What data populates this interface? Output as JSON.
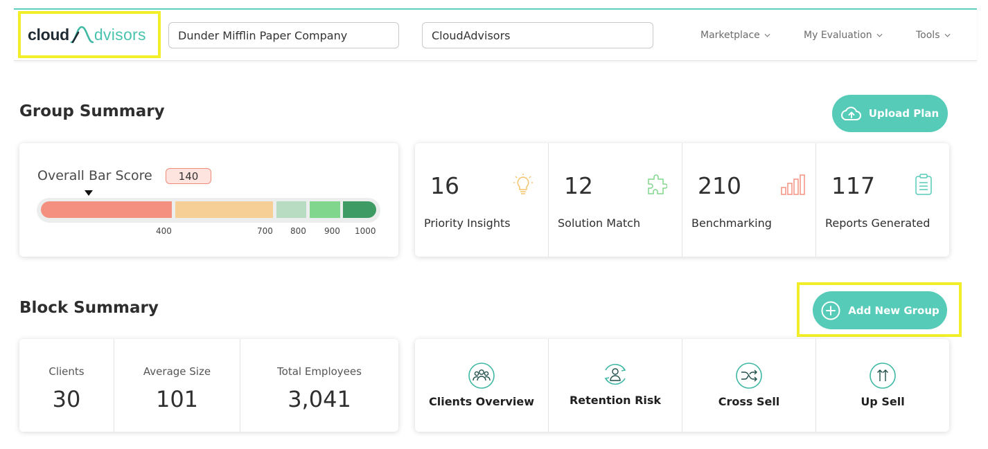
{
  "brand": {
    "logo_part1": "cloud",
    "logo_part2": "dvisors",
    "accent": "#55cbb8",
    "highlight": "#f2ef2a"
  },
  "header": {
    "company_field": "Dunder Mifflin Paper Company",
    "advisor_field": "CloudAdvisors",
    "nav": [
      {
        "label": "Marketplace",
        "icon": "chevron-down-icon"
      },
      {
        "label": "My Evaluation",
        "icon": "chevron-down-icon"
      },
      {
        "label": "Tools",
        "icon": "chevron-down-icon"
      }
    ]
  },
  "group_summary": {
    "title": "Group Summary",
    "upload_button": "Upload Plan",
    "bar_score": {
      "label": "Overall Bar Score",
      "value": "140",
      "ticks": [
        "400",
        "700",
        "800",
        "900",
        "1000"
      ],
      "segment_colors": [
        "#f4907f",
        "#f5cf95",
        "#b7dcc2",
        "#7fd68c",
        "#3e9b63"
      ]
    },
    "stats": [
      {
        "value": "16",
        "label": "Priority Insights",
        "icon": "lightbulb-icon",
        "color": "#f5c36b"
      },
      {
        "value": "12",
        "label": "Solution Match",
        "icon": "puzzle-icon",
        "color": "#7fd68c"
      },
      {
        "value": "210",
        "label": "Benchmarking",
        "icon": "bar-chart-icon",
        "color": "#f4907f"
      },
      {
        "value": "117",
        "label": "Reports Generated",
        "icon": "clipboard-icon",
        "color": "#55cbb8"
      }
    ]
  },
  "block_summary": {
    "title": "Block Summary",
    "add_button": "Add New Group",
    "metrics": [
      {
        "label": "Clients",
        "value": "30"
      },
      {
        "label": "Average Size",
        "value": "101"
      },
      {
        "label": "Total Employees",
        "value": "3,041"
      }
    ],
    "actions": [
      {
        "label": "Clients Overview",
        "icon": "users-group-icon"
      },
      {
        "label": "Retention Risk",
        "icon": "user-retention-icon"
      },
      {
        "label": "Cross Sell",
        "icon": "shuffle-icon"
      },
      {
        "label": "Up Sell",
        "icon": "arrows-up-icon"
      }
    ]
  }
}
